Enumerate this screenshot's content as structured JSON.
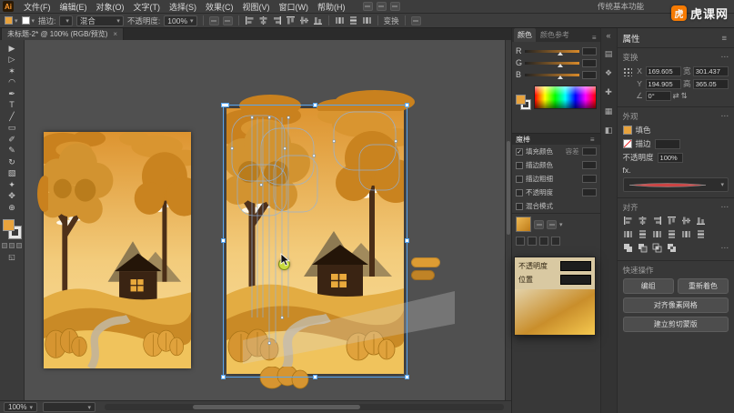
{
  "app": {
    "logo_text": "Ai",
    "workspace": "传统基本功能",
    "watermark_text": "虎课网",
    "watermark_logo": "虎"
  },
  "menubar": {
    "items": [
      "文件(F)",
      "编辑(E)",
      "对象(O)",
      "文字(T)",
      "选择(S)",
      "效果(C)",
      "视图(V)",
      "窗口(W)",
      "帮助(H)"
    ]
  },
  "controlbar": {
    "stroke_label": "描边:",
    "stroke_value": "",
    "brush_value": "混合",
    "opacity_label": "不透明度:",
    "opacity_value": "100%",
    "transform_label": "变换"
  },
  "doctab": {
    "title": "未标题-2* @ 100% (RGB/预览)",
    "close": "×"
  },
  "toolbar": {
    "tools": [
      {
        "glyph": "▶"
      },
      {
        "glyph": "▷"
      },
      {
        "glyph": "✶"
      },
      {
        "glyph": "◠"
      },
      {
        "glyph": "✒"
      },
      {
        "glyph": "T"
      },
      {
        "glyph": "╱"
      },
      {
        "glyph": "▭"
      },
      {
        "glyph": "✐"
      },
      {
        "glyph": "✎"
      },
      {
        "glyph": "↻"
      },
      {
        "glyph": "▧"
      },
      {
        "glyph": "✦"
      },
      {
        "glyph": "✥"
      },
      {
        "glyph": "⊕"
      }
    ]
  },
  "color_panel": {
    "tab_color": "颜色",
    "tab_guide": "颜色参考",
    "sliders": [
      {
        "ch": "R",
        "val": ""
      },
      {
        "ch": "G",
        "val": ""
      },
      {
        "ch": "B",
        "val": ""
      }
    ]
  },
  "wand_panel": {
    "title": "魔棒",
    "tolerance_label": "容差",
    "rows": [
      {
        "label": "填充颜色",
        "check": "✓"
      },
      {
        "label": "描边颜色",
        "check": ""
      },
      {
        "label": "描边粗细",
        "check": ""
      },
      {
        "label": "不透明度",
        "check": ""
      },
      {
        "label": "混合模式",
        "check": ""
      }
    ]
  },
  "gradient_popup": {
    "opacity_label": "不透明度",
    "location_label": "位置"
  },
  "properties": {
    "title": "属性",
    "transform_label": "变换",
    "x_label": "X",
    "x_value": "169.605",
    "y_label": "Y",
    "y_value": "194.905",
    "w_label": "宽",
    "w_value": "301.437",
    "h_label": "高",
    "h_value": "365.05",
    "angle_value": "0°",
    "appearance_label": "外观",
    "fill_label": "填色",
    "stroke_label": "描边",
    "opacity_label": "不透明度",
    "opacity_value": "100%",
    "fx_label": "fx.",
    "align_label": "对齐",
    "quick_label": "快速操作",
    "buttons": [
      "编组",
      "重新着色",
      "对齐像素网格",
      "建立剪切蒙版"
    ]
  },
  "statusbar": {
    "zoom": "100%"
  },
  "canvas": {
    "palette": {
      "sky_top": "#DD9430",
      "sky_bottom": "#F6DD9C",
      "cloud_dark": "#C9811E",
      "cloud_light": "#D99530",
      "foliage": "#D29330",
      "trunk": "#4A2E17",
      "house": "#3A2413",
      "hill_back": "#E3AC42",
      "hill_mid": "#C98A26",
      "hill_front": "#F0C35C",
      "road": "#C4B496",
      "selection_blue": "#58A6F0",
      "anchor_highlight": "#C8DA3C"
    }
  }
}
